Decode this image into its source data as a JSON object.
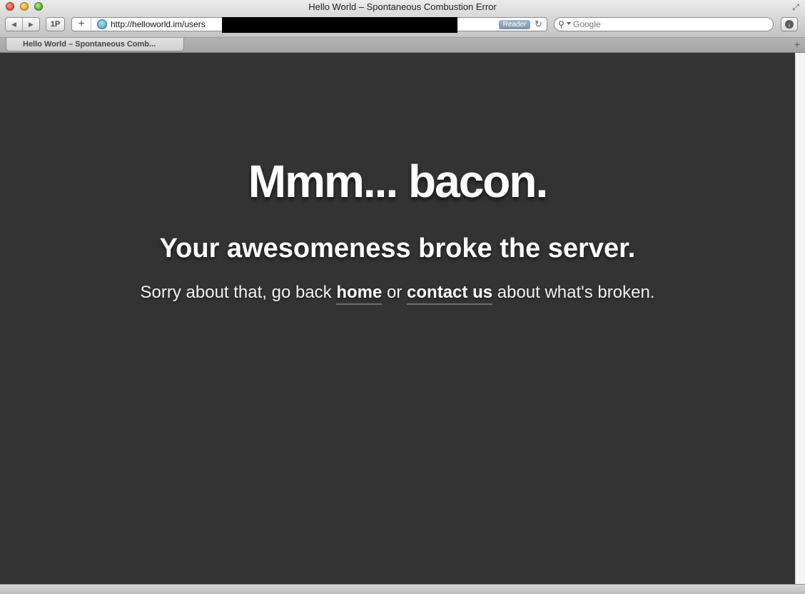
{
  "window": {
    "title": "Hello World – Spontaneous Combustion Error"
  },
  "toolbar": {
    "onepassword_label": "1P",
    "back_icon": "◀",
    "forward_icon": "▶",
    "plus_icon": "+",
    "reader_label": "Reader",
    "reload_icon": "↻",
    "download_icon": "↓"
  },
  "address_bar": {
    "url": "http://helloworld.im/users"
  },
  "search": {
    "placeholder": "Google"
  },
  "tabs": [
    {
      "label": "Hello World – Spontaneous Comb..."
    }
  ],
  "page": {
    "headline": "Mmm... bacon.",
    "subheadline": "Your awesomeness broke the server.",
    "message_prefix": "Sorry about that, go back ",
    "home_link": "home",
    "message_middle": " or ",
    "contact_link": "contact us",
    "message_suffix": " about what's broken."
  },
  "colors": {
    "page_background": "#333333",
    "text": "#ffffff",
    "link_underline": "#6e6e6e"
  }
}
